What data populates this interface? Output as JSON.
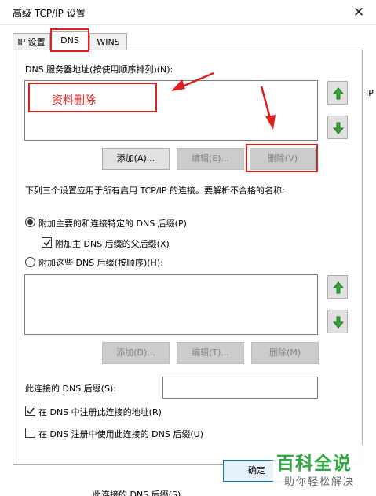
{
  "window": {
    "title": "高级 TCP/IP 设置",
    "close_glyph": "✕"
  },
  "tabs": [
    {
      "label": "IP 设置"
    },
    {
      "label": "DNS"
    },
    {
      "label": "WINS"
    }
  ],
  "dns_servers": {
    "label": "DNS 服务器地址(按使用顺序排列)(N):",
    "add_label": "添加(A)...",
    "edit_label": "编辑(E)...",
    "remove_label": "删除(V)"
  },
  "info_text": "下列三个设置应用于所有启用 TCP/IP 的连接。要解析不合格的名称:",
  "options": {
    "primary_suffix": "附加主要的和连接特定的 DNS 后缀(P)",
    "parent_suffix": "附加主 DNS 后缀的父后缀(X)",
    "these_suffixes": "附加这些 DNS 后缀(按顺序)(H):"
  },
  "suffix_buttons": {
    "add_label": "添加(D)...",
    "edit_label": "编辑(T)...",
    "remove_label": "删除(M)"
  },
  "connection_suffix": {
    "label": "此连接的 DNS 后缀(S):",
    "value": ""
  },
  "checkboxes": {
    "register": "在 DNS 中注册此连接的地址(R)",
    "use_suffix": "在 DNS 注册中使用此连接的 DNS 后缀(U)"
  },
  "ok_label": "确定",
  "annotation": {
    "text": "资料删除",
    "color": "#e0201f"
  },
  "right_clip_text": "IP",
  "bottom_clip_text": "此连接的 DNS 后缀(S)",
  "watermark": {
    "main": "百科全说",
    "sub": "助你轻松解决",
    "color": "#2eaa3f"
  }
}
